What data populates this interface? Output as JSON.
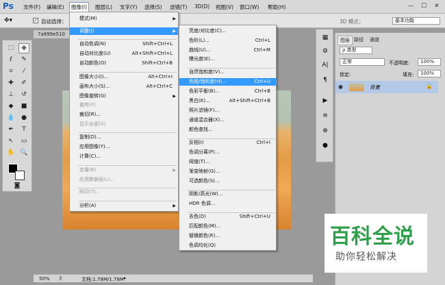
{
  "app": {
    "logo": "Ps"
  },
  "menubar": {
    "items": [
      "文件(F)",
      "编辑(E)",
      "图像(I)",
      "图层(L)",
      "文字(Y)",
      "选择(S)",
      "滤镜(T)",
      "3D(D)",
      "视图(V)",
      "窗口(W)",
      "帮助(H)"
    ],
    "active": "图像(I)",
    "win": [
      "—",
      "☐",
      "✕"
    ]
  },
  "options": {
    "auto_select": "自动选择：",
    "mode3d": "3D 模式：",
    "workspace": "基本功能"
  },
  "doc": {
    "tab": "7a899e510",
    "zoom": "50%",
    "info": "文档:1.78M/1.78M"
  },
  "image_menu": {
    "items": [
      {
        "label": "模式(M)",
        "sc": "",
        "arrow": true,
        "dis": false
      },
      {
        "label": "调整(J)",
        "sc": "",
        "arrow": true,
        "dis": false,
        "hl": true
      },
      {
        "label": "自动色调(N)",
        "sc": "Shift+Ctrl+L"
      },
      {
        "label": "自动对比度(U)",
        "sc": "Alt+Shift+Ctrl+L"
      },
      {
        "label": "自动颜色(O)",
        "sc": "Shift+Ctrl+B"
      },
      {
        "label": "图像大小(I)...",
        "sc": "Alt+Ctrl+I"
      },
      {
        "label": "画布大小(S)...",
        "sc": "Alt+Ctrl+C"
      },
      {
        "label": "图像旋转(G)",
        "sc": "",
        "arrow": true
      },
      {
        "label": "裁剪(P)",
        "sc": "",
        "dis": true
      },
      {
        "label": "裁切(R)...",
        "sc": ""
      },
      {
        "label": "显示全部(V)",
        "sc": "",
        "dis": true
      },
      {
        "label": "复制(D)...",
        "sc": ""
      },
      {
        "label": "应用图像(Y)...",
        "sc": ""
      },
      {
        "label": "计算(C)...",
        "sc": ""
      },
      {
        "label": "变量(B)",
        "sc": "",
        "arrow": true,
        "dis": true
      },
      {
        "label": "应用数据组(L)...",
        "sc": "",
        "dis": true
      },
      {
        "label": "陷印(T)...",
        "sc": "",
        "dis": true
      },
      {
        "label": "分析(A)",
        "sc": "",
        "arrow": true
      }
    ]
  },
  "adjust_menu": {
    "items": [
      {
        "label": "亮度/对比度(C)...",
        "sc": ""
      },
      {
        "label": "色阶(L)...",
        "sc": "Ctrl+L"
      },
      {
        "label": "曲线(U)...",
        "sc": "Ctrl+M"
      },
      {
        "label": "曝光度(E)...",
        "sc": ""
      },
      {
        "label": "自然饱和度(V)...",
        "sc": ""
      },
      {
        "label": "色相/饱和度(H)...",
        "sc": "Ctrl+U",
        "hl": true
      },
      {
        "label": "色彩平衡(B)...",
        "sc": "Ctrl+B"
      },
      {
        "label": "黑白(K)...",
        "sc": "Alt+Shift+Ctrl+B"
      },
      {
        "label": "照片滤镜(F)...",
        "sc": ""
      },
      {
        "label": "通道混合器(X)...",
        "sc": ""
      },
      {
        "label": "颜色查找...",
        "sc": ""
      },
      {
        "label": "反相(I)",
        "sc": "Ctrl+I"
      },
      {
        "label": "色调分离(P)...",
        "sc": ""
      },
      {
        "label": "阈值(T)...",
        "sc": ""
      },
      {
        "label": "渐变映射(G)...",
        "sc": ""
      },
      {
        "label": "可选颜色(S)...",
        "sc": ""
      },
      {
        "label": "阴影/高光(W)...",
        "sc": ""
      },
      {
        "label": "HDR 色调...",
        "sc": ""
      },
      {
        "label": "去色(D)",
        "sc": "Shift+Ctrl+U"
      },
      {
        "label": "匹配颜色(M)...",
        "sc": ""
      },
      {
        "label": "替换颜色(R)...",
        "sc": ""
      },
      {
        "label": "色调均化(Q)",
        "sc": ""
      }
    ]
  },
  "layers": {
    "tabs": [
      "图层",
      "路径",
      "通道"
    ],
    "kind": "ρ 类型",
    "blend": "正常",
    "opacity_label": "不透明度:",
    "opacity": "100%",
    "lock_label": "锁定:",
    "fill_label": "填充:",
    "fill": "100%",
    "layer_name": "背景"
  },
  "watermark": {
    "title": "百科全说",
    "subtitle": "助你轻松解决"
  }
}
